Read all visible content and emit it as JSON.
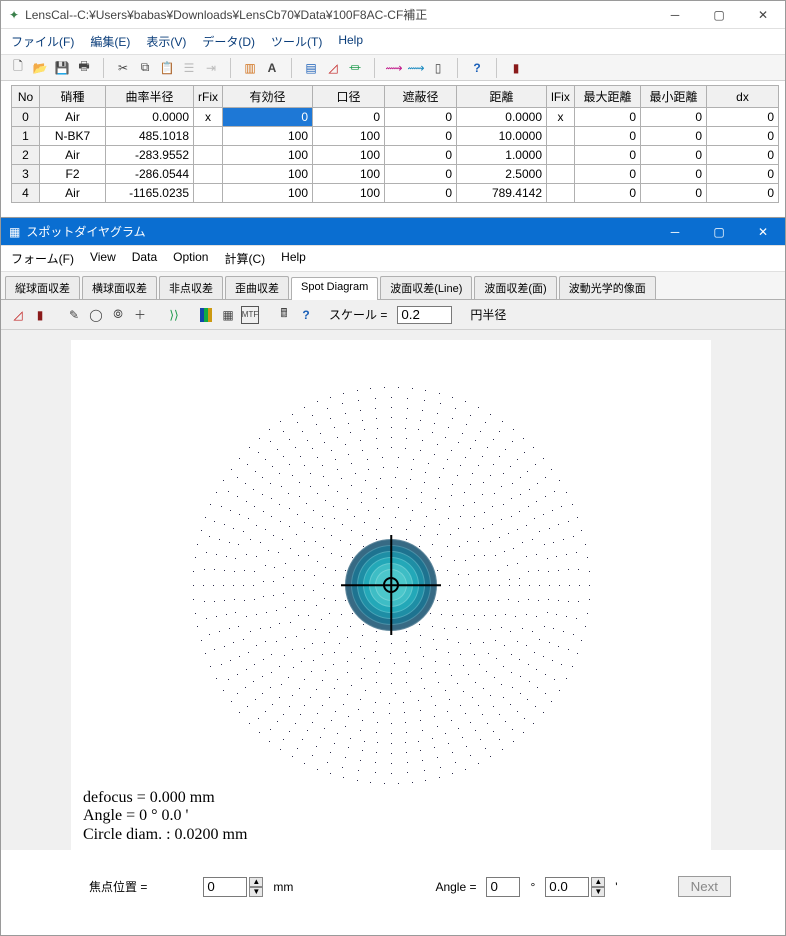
{
  "main_window": {
    "title": "LensCal--C:¥Users¥babas¥Downloads¥LensCb70¥Data¥100F8AC-CF補正",
    "menu": [
      "ファイル(F)",
      "編集(E)",
      "表示(V)",
      "データ(D)",
      "ツール(T)",
      "Help"
    ]
  },
  "table": {
    "headers": [
      "No",
      "硝種",
      "曲率半径",
      "rFix",
      "有効径",
      "口径",
      "遮蔽径",
      "距離",
      "lFix",
      "最大距離",
      "最小距離",
      "dx"
    ],
    "rows": [
      {
        "no": "0",
        "glass": "Air",
        "r": "0.0000",
        "rfix": "x",
        "eff": "0",
        "ap": "0",
        "obs": "0",
        "dist": "0.0000",
        "lfix": "x",
        "max": "0",
        "min": "0",
        "dx": "0"
      },
      {
        "no": "1",
        "glass": "N-BK7",
        "r": "485.1018",
        "rfix": "",
        "eff": "100",
        "ap": "100",
        "obs": "0",
        "dist": "10.0000",
        "lfix": "",
        "max": "0",
        "min": "0",
        "dx": "0"
      },
      {
        "no": "2",
        "glass": "Air",
        "r": "-283.9552",
        "rfix": "",
        "eff": "100",
        "ap": "100",
        "obs": "0",
        "dist": "1.0000",
        "lfix": "",
        "max": "0",
        "min": "0",
        "dx": "0"
      },
      {
        "no": "3",
        "glass": "F2",
        "r": "-286.0544",
        "rfix": "",
        "eff": "100",
        "ap": "100",
        "obs": "0",
        "dist": "2.5000",
        "lfix": "",
        "max": "0",
        "min": "0",
        "dx": "0"
      },
      {
        "no": "4",
        "glass": "Air",
        "r": "-1165.0235",
        "rfix": "",
        "eff": "100",
        "ap": "100",
        "obs": "0",
        "dist": "789.4142",
        "lfix": "",
        "max": "0",
        "min": "0",
        "dx": "0"
      }
    ]
  },
  "inner_window": {
    "title": "スポットダイヤグラム",
    "menu": [
      "フォーム(F)",
      "View",
      "Data",
      "Option",
      "計算(C)",
      "Help"
    ],
    "tabs": [
      "縦球面収差",
      "横球面収差",
      "非点収差",
      "歪曲収差",
      "Spot Diagram",
      "波面収差(Line)",
      "波面収差(面)",
      "波動光学的像面"
    ],
    "active_tab": 4,
    "scale_label": "スケール =",
    "scale_value": "0.2",
    "scale_unit": "円半径",
    "caption_defocus": "defocus = 0.000 mm",
    "caption_angle": "Angle   = 0 °  0.0 '",
    "caption_circle": "Circle diam. : 0.0200 mm",
    "focus_label": "焦点位置 =",
    "focus_value": "0",
    "focus_unit": "mm",
    "angle_label": "Angle =",
    "angle_deg": "0",
    "angle_min": "0.0",
    "deg_sym": "°",
    "min_sym": "'",
    "next_label": "Next"
  },
  "chart_data": {
    "type": "scatter",
    "title": "Spot Diagram",
    "angle_deg": 0,
    "angle_min": 0.0,
    "defocus_mm": 0.0,
    "circle_diam_mm": 0.02,
    "scale_circle_radius": 0.2
  }
}
